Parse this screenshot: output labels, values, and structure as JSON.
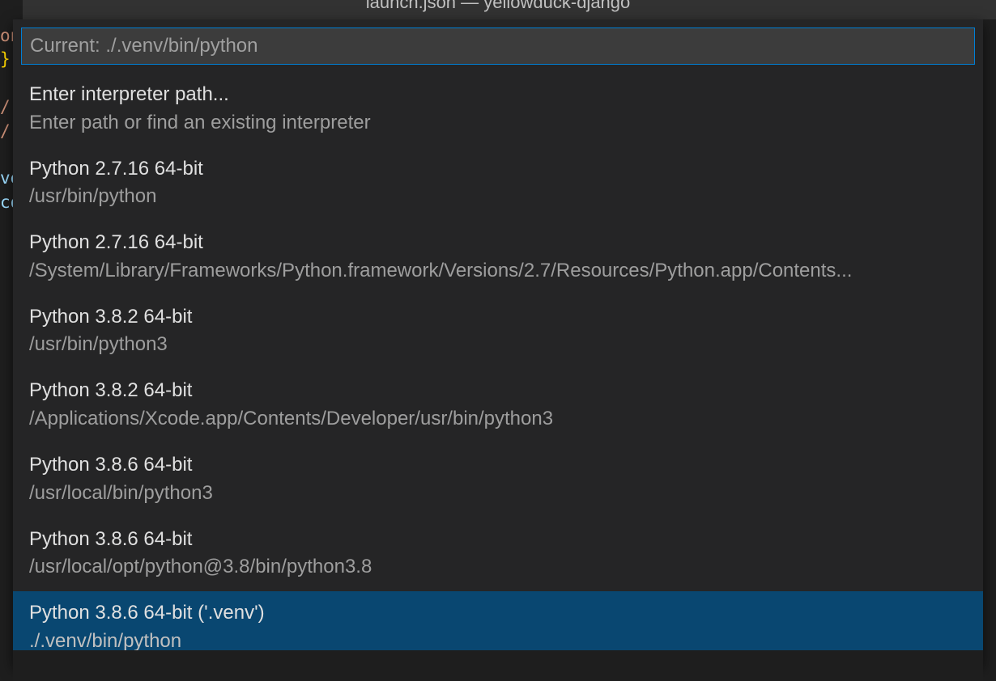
{
  "titleBar": {
    "text": "launch.json — yellowduck-django"
  },
  "quickOpen": {
    "placeholder": "Current: ./.venv/bin/python",
    "items": [
      {
        "label": "Enter interpreter path...",
        "description": "Enter path or find an existing interpreter",
        "selected": false
      },
      {
        "label": "Python 2.7.16 64-bit",
        "description": "/usr/bin/python",
        "selected": false
      },
      {
        "label": "Python 2.7.16 64-bit",
        "description": "/System/Library/Frameworks/Python.framework/Versions/2.7/Resources/Python.app/Contents...",
        "selected": false
      },
      {
        "label": "Python 3.8.2 64-bit",
        "description": "/usr/bin/python3",
        "selected": false
      },
      {
        "label": "Python 3.8.2 64-bit",
        "description": "/Applications/Xcode.app/Contents/Developer/usr/bin/python3",
        "selected": false
      },
      {
        "label": "Python 3.8.6 64-bit",
        "description": "/usr/local/bin/python3",
        "selected": false
      },
      {
        "label": "Python 3.8.6 64-bit",
        "description": "/usr/local/opt/python@3.8/bin/python3.8",
        "selected": false
      },
      {
        "label": "Python 3.8.6 64-bit ('.venv')",
        "description": "./.venv/bin/python",
        "selected": true
      }
    ]
  },
  "editor": {
    "lines": [
      {
        "text": "on",
        "cls": "str"
      },
      {
        "text": "}",
        "cls": "brace"
      },
      {
        "text": "",
        "cls": ""
      },
      {
        "text": "/",
        "cls": "str"
      },
      {
        "text": "/",
        "cls": "str"
      },
      {
        "text": "",
        "cls": ""
      },
      {
        "text": "ve",
        "cls": "blue-text"
      },
      {
        "text": "co",
        "cls": "blue-text"
      }
    ]
  }
}
